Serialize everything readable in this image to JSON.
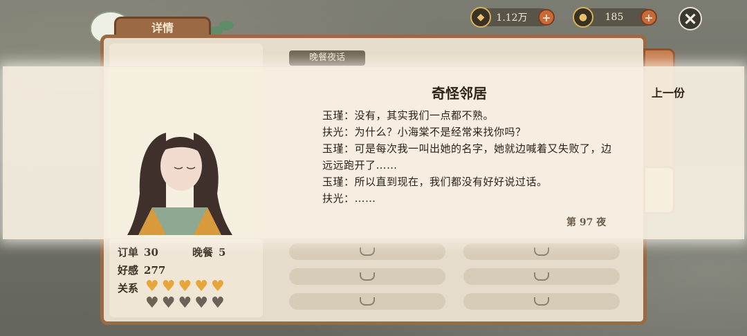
{
  "header": {
    "tab_title": "详情",
    "coins": "1.12万",
    "gems": "185"
  },
  "story": {
    "tag": "晚餐夜话",
    "dialog_title": "奇怪邻居",
    "prev_label": "上一份",
    "lines": [
      "玉瑾：没有，其实我们一点都不熟。",
      "扶光：为什么？小海棠不是经常来找你吗？",
      "玉瑾：可是每次我一叫出她的名字，她就边喊着又失败了，边远远跑开了……",
      "玉瑾：所以直到现在，我们都没有好好说过话。",
      "扶光：……"
    ],
    "night_label": "第 97 夜"
  },
  "stats": {
    "order_label": "订单",
    "order_value": "30",
    "dinner_label": "晚餐",
    "dinner_value": "5",
    "favor_label": "好感",
    "favor_value": "277",
    "relation_label": "关系",
    "relation_level": 5,
    "relation_max": 10
  },
  "colors": {
    "heart_filled": "#e6a63a",
    "heart_empty": "#6b6358"
  },
  "icons": {
    "coin": "coin-icon",
    "gem": "gem-icon",
    "close": "close-icon"
  }
}
